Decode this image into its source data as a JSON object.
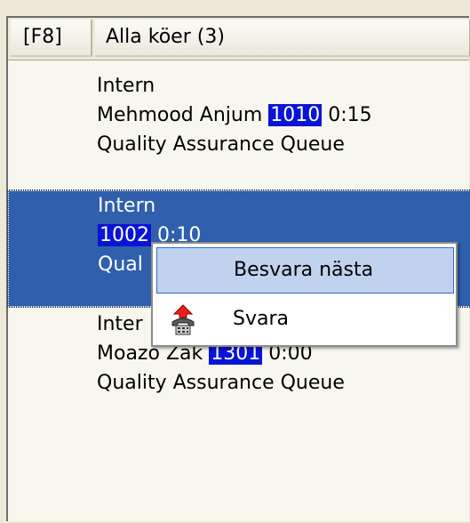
{
  "header": {
    "hotkey": "[F8]",
    "title": "Alla köer (3)"
  },
  "queue_items": [
    {
      "line1": "Intern",
      "name": "Mehmood Anjum",
      "extension": "1010",
      "time": "0:15",
      "queue": "Quality Assurance Queue",
      "selected": false
    },
    {
      "line1": "Intern",
      "name": "",
      "extension": "1002",
      "time": "0:10",
      "queue": "Qual",
      "selected": true
    },
    {
      "line1": "Inter",
      "name": "Moazo Zak",
      "extension": "1301",
      "time": "0:00",
      "queue": "Quality Assurance Queue",
      "selected": false
    }
  ],
  "context_menu": {
    "items": [
      {
        "label": "Besvara nästa",
        "icon": "",
        "highlighted": true
      },
      {
        "label": "Svara",
        "icon": "phone-answer-icon",
        "highlighted": false
      }
    ]
  },
  "colors": {
    "selection": "#2f5fad",
    "extension_highlight": "#0a14d6",
    "menu_highlight": "#c1d2ee"
  }
}
